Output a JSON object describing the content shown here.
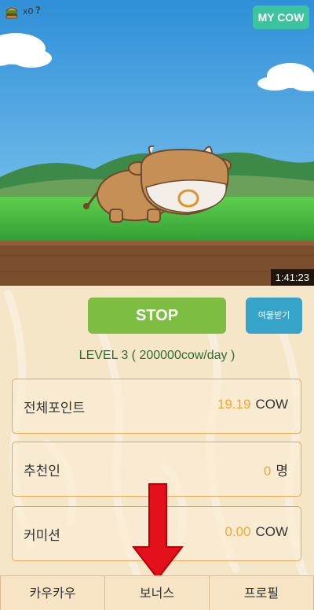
{
  "hud": {
    "burger_icon": "burger-icon",
    "burger_count": "x0",
    "help_label": "?",
    "my_cow_label": "MY COW"
  },
  "video": {
    "timer": "1:41:23"
  },
  "controls": {
    "stop_label": "STOP",
    "receive_label": "여물받기"
  },
  "level_text": "LEVEL  3 ( 200000cow/day )",
  "cards": [
    {
      "label": "전체포인트",
      "number": "19.19",
      "unit": "COW"
    },
    {
      "label": "추천인",
      "number": "0",
      "unit": "명"
    },
    {
      "label": "커미션",
      "number": "0.00",
      "unit": "COW"
    }
  ],
  "tabs": [
    {
      "label": "카우카우"
    },
    {
      "label": "보너스"
    },
    {
      "label": "프로필"
    }
  ],
  "colors": {
    "accent_green": "#7cbd42",
    "accent_blue": "#36a3c9",
    "my_cow": "#3cc39f",
    "number_orange": "#f1a634",
    "level_green": "#2f6b35",
    "card_border": "#e9a559",
    "arrow_red": "#e3101b"
  }
}
